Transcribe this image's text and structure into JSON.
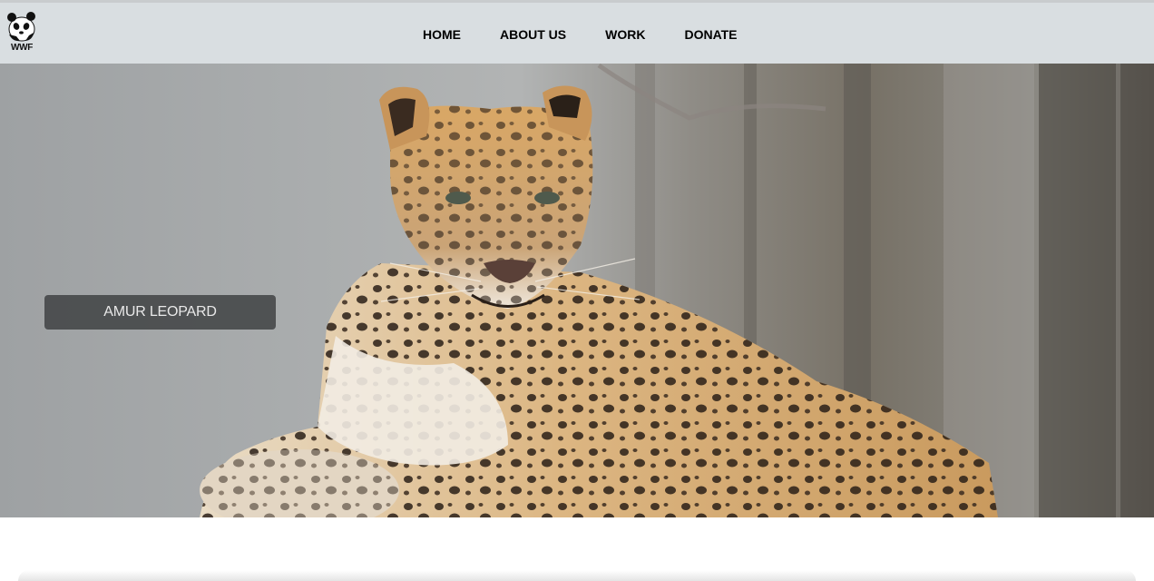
{
  "logo": {
    "text": "WWF",
    "icon": "panda-logo-icon"
  },
  "nav": {
    "items": [
      {
        "label": "HOME"
      },
      {
        "label": "ABOUT US"
      },
      {
        "label": "WORK"
      },
      {
        "label": "DONATE"
      }
    ]
  },
  "hero": {
    "image": "amur-leopard-photo",
    "caption": "AMUR LEOPARD"
  },
  "colors": {
    "navbar_bg": "#d9dee1",
    "caption_bg": "#3c3e40",
    "caption_text": "#e8e8e8"
  }
}
